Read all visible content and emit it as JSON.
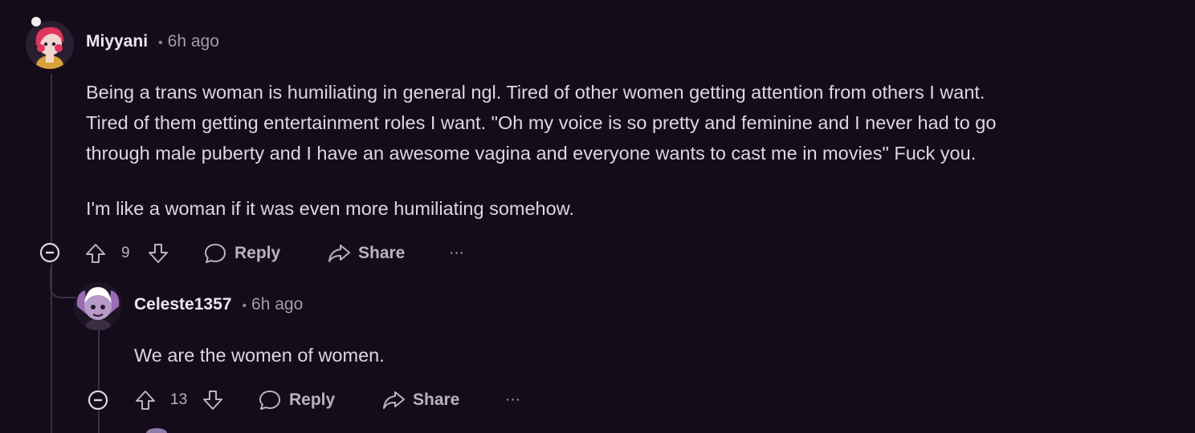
{
  "comments": [
    {
      "username": "Miyyani",
      "separator": "•",
      "time": "6h ago",
      "avatar_icon": "avatar-pink-hair-icon",
      "paragraphs": [
        "Being a trans woman is humiliating in general ngl. Tired of other women getting attention from others I want.",
        "Tired of them getting entertainment roles I want. \"Oh my voice is so pretty and feminine and I never had to go",
        "through male puberty and I have an awesome vagina and everyone wants to cast me in movies\" Fuck you.",
        "I'm like a woman if it was even more humiliating somehow."
      ],
      "vote_count": "9",
      "reply_label": "Reply",
      "share_label": "Share",
      "more_label": "···"
    },
    {
      "username": "Celeste1357",
      "separator": "•",
      "time": "6h ago",
      "avatar_icon": "avatar-purple-character-icon",
      "paragraphs": [
        "We are the women of women."
      ],
      "vote_count": "13",
      "reply_label": "Reply",
      "share_label": "Share",
      "more_label": "···"
    }
  ],
  "colors": {
    "background": "#140c1b",
    "text": "#dcd7e2",
    "muted": "#a39daa",
    "thread_line": "#3a3042"
  }
}
